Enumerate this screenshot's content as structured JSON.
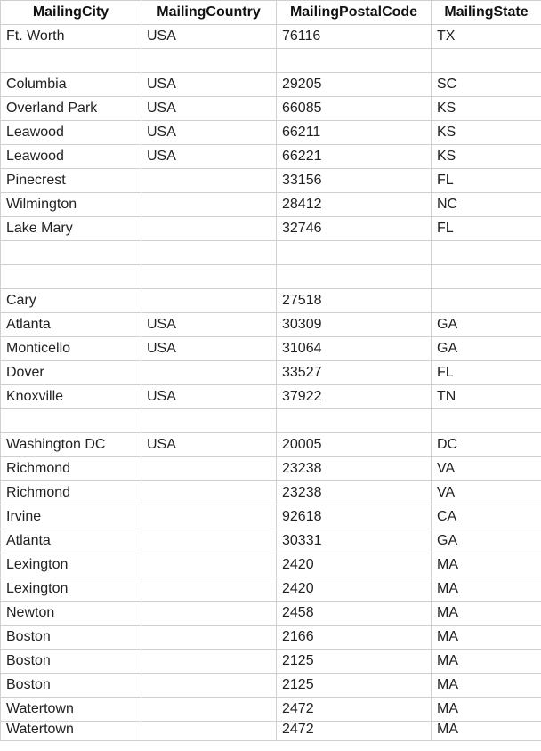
{
  "columns": [
    "MailingCity",
    "MailingCountry",
    "MailingPostalCode",
    "MailingState"
  ],
  "rows": [
    {
      "city": "Ft. Worth",
      "country": "USA",
      "postal": "76116",
      "state": "TX"
    },
    {
      "city": "",
      "country": "",
      "postal": "",
      "state": ""
    },
    {
      "city": "Columbia",
      "country": "USA",
      "postal": "29205",
      "state": "SC"
    },
    {
      "city": "Overland Park",
      "country": "USA",
      "postal": "66085",
      "state": "KS"
    },
    {
      "city": "Leawood",
      "country": "USA",
      "postal": "66211",
      "state": "KS"
    },
    {
      "city": "Leawood",
      "country": "USA",
      "postal": "66221",
      "state": "KS"
    },
    {
      "city": "Pinecrest",
      "country": "",
      "postal": "33156",
      "state": "FL"
    },
    {
      "city": "Wilmington",
      "country": "",
      "postal": "28412",
      "state": "NC"
    },
    {
      "city": "Lake Mary",
      "country": "",
      "postal": "32746",
      "state": "FL"
    },
    {
      "city": "",
      "country": "",
      "postal": "",
      "state": ""
    },
    {
      "city": "",
      "country": "",
      "postal": "",
      "state": ""
    },
    {
      "city": "Cary",
      "country": "",
      "postal": "27518",
      "state": ""
    },
    {
      "city": "Atlanta",
      "country": "USA",
      "postal": "30309",
      "state": "GA"
    },
    {
      "city": "Monticello",
      "country": "USA",
      "postal": "31064",
      "state": "GA"
    },
    {
      "city": "Dover",
      "country": "",
      "postal": "33527",
      "state": "FL"
    },
    {
      "city": "Knoxville",
      "country": "USA",
      "postal": "37922",
      "state": "TN"
    },
    {
      "city": "",
      "country": "",
      "postal": "",
      "state": ""
    },
    {
      "city": "Washington DC",
      "country": "USA",
      "postal": "20005",
      "state": "DC"
    },
    {
      "city": "Richmond",
      "country": "",
      "postal": "23238",
      "state": "VA"
    },
    {
      "city": "Richmond",
      "country": "",
      "postal": "23238",
      "state": "VA"
    },
    {
      "city": "Irvine",
      "country": "",
      "postal": "92618",
      "state": "CA"
    },
    {
      "city": "Atlanta",
      "country": "",
      "postal": "30331",
      "state": "GA"
    },
    {
      "city": "Lexington",
      "country": "",
      "postal": "2420",
      "state": "MA"
    },
    {
      "city": "Lexington",
      "country": "",
      "postal": "2420",
      "state": "MA"
    },
    {
      "city": "Newton",
      "country": "",
      "postal": "2458",
      "state": "MA"
    },
    {
      "city": "Boston",
      "country": "",
      "postal": "2166",
      "state": "MA"
    },
    {
      "city": "Boston",
      "country": "",
      "postal": "2125",
      "state": "MA"
    },
    {
      "city": "Boston",
      "country": "",
      "postal": "2125",
      "state": "MA"
    },
    {
      "city": "Watertown",
      "country": "",
      "postal": "2472",
      "state": "MA"
    },
    {
      "city": "Watertown",
      "country": "",
      "postal": "2472",
      "state": "MA"
    }
  ]
}
